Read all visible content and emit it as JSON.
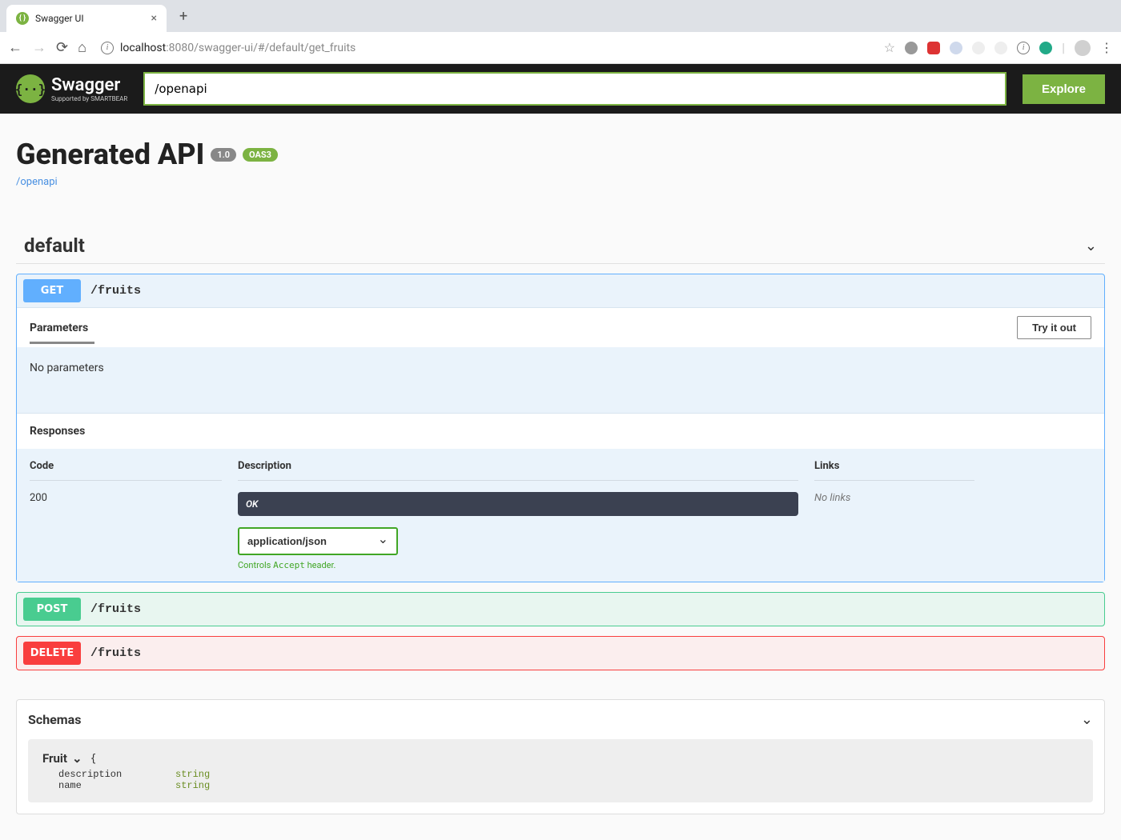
{
  "browser": {
    "tab_title": "Swagger UI",
    "url": {
      "host": "localhost",
      "port": ":8080",
      "path": "/swagger-ui/#/default/get_fruits"
    }
  },
  "header": {
    "logo_text": "Swagger",
    "logo_sub": "Supported by SMARTBEAR",
    "spec_input_value": "/openapi",
    "explore_label": "Explore"
  },
  "api": {
    "title": "Generated API",
    "version": "1.0",
    "oas": "OAS3",
    "spec_link": "/openapi"
  },
  "tag": {
    "name": "default"
  },
  "operations": [
    {
      "method": "GET",
      "path": "/fruits",
      "expanded": true
    },
    {
      "method": "POST",
      "path": "/fruits",
      "expanded": false
    },
    {
      "method": "DELETE",
      "path": "/fruits",
      "expanded": false
    }
  ],
  "get_detail": {
    "params_label": "Parameters",
    "try_label": "Try it out",
    "no_params": "No parameters",
    "responses_label": "Responses",
    "th_code": "Code",
    "th_desc": "Description",
    "th_links": "Links",
    "code": "200",
    "ok_text": "OK",
    "content_type": "application/json",
    "accept_hint_pre": "Controls ",
    "accept_hint_mono": "Accept",
    "accept_hint_post": " header.",
    "no_links": "No links"
  },
  "schemas": {
    "title": "Schemas",
    "model_name": "Fruit",
    "props": [
      {
        "name": "description",
        "type": "string"
      },
      {
        "name": "name",
        "type": "string"
      }
    ]
  }
}
